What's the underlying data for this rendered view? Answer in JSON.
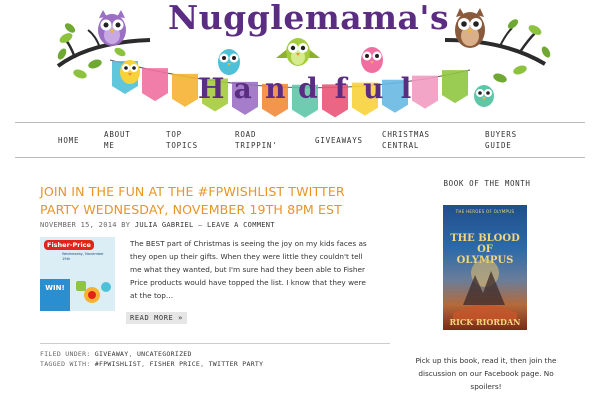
{
  "header": {
    "site_title": "Nugglemama's",
    "subtitle_letters": [
      "H",
      "a",
      "n",
      "d",
      "f",
      "u",
      "l"
    ],
    "banner_colors": [
      "#4ec0d8",
      "#f06fa0",
      "#f7b233",
      "#a4cc3c",
      "#9b6fc4",
      "#f38a3b",
      "#5fc6a9",
      "#e95577",
      "#f7d23b",
      "#69b8e3",
      "#f29bc1",
      "#8fc640"
    ],
    "owl_icons": [
      "owl-purple",
      "owl-green",
      "owl-teal",
      "owl-yellow",
      "owl-pink",
      "owl-brown",
      "owl-small"
    ]
  },
  "nav": {
    "items": [
      {
        "label": "HOME"
      },
      {
        "label": "ABOUT\nME"
      },
      {
        "label": "TOP\nTOPICS"
      },
      {
        "label": "ROAD\nTRIPPIN'"
      },
      {
        "label": "GIVEAWAYS"
      },
      {
        "label": "CHRISTMAS\nCENTRAL"
      },
      {
        "label": "BUYERS\nGUIDE"
      }
    ]
  },
  "post": {
    "title": "Join in the Fun at the #FPWishList Twitter Party Wednesday, November 19th 8pm EST",
    "date": "NOVEMBER 15, 2014",
    "by": "BY",
    "author": "JULIA GABRIEL",
    "separator": "—",
    "comment_link": "LEAVE A COMMENT",
    "thumbnail": {
      "brand": "Fisher-Price",
      "text": "Wednesday, November 19th",
      "win": "WIN!"
    },
    "excerpt": "The BEST part of Christmas is seeing the joy on my kids faces as they open up their gifts. When they were little they couldn't tell me what they wanted, but I'm sure had they been able to Fisher Price products would have topped the list. I know that they were at the top…",
    "read_more": "READ MORE »",
    "filed_under_label": "FILED UNDER:",
    "categories": [
      "GIVEAWAY",
      "UNCATEGORIZED"
    ],
    "tagged_with_label": "TAGGED WITH:",
    "tags": [
      "#FPWISHLIST",
      "FISHER PRICE",
      "TWITTER PARTY"
    ]
  },
  "sidebar": {
    "widget_title": "BOOK OF THE MONTH",
    "book": {
      "series": "THE HEROES OF OLYMPUS",
      "title": "THE BLOOD OF OLYMPUS",
      "author": "RICK RIORDAN"
    },
    "widget_text": "Pick up this book, read it, then join the discussion on our Facebook page. No spoilers!"
  }
}
